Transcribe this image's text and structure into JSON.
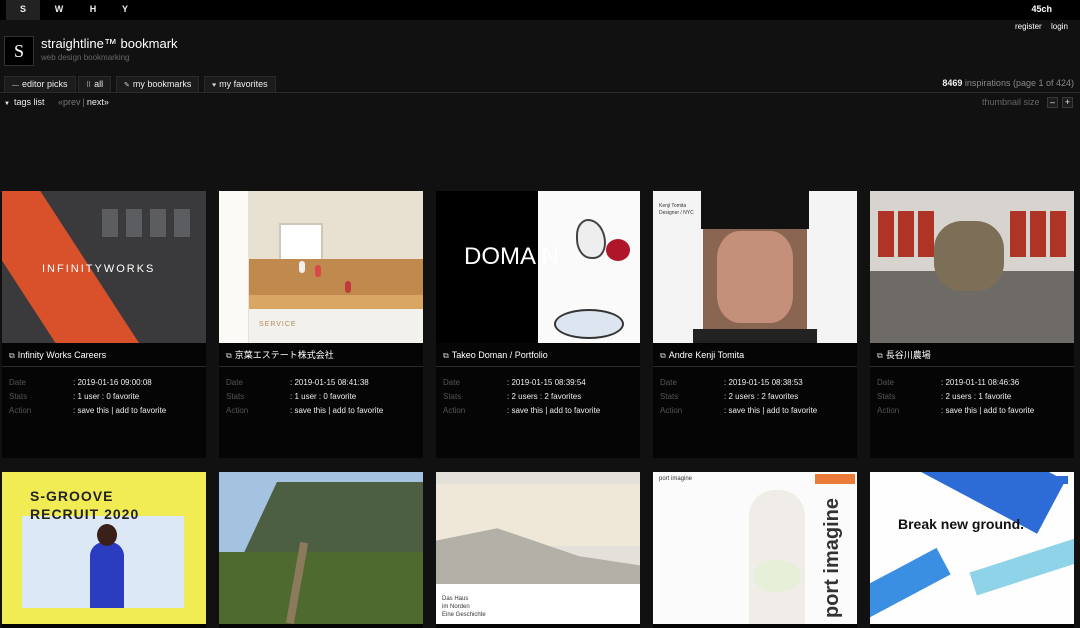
{
  "top_tabs": [
    "S",
    "W",
    "H",
    "Y"
  ],
  "site_code": "45ch",
  "account": {
    "register": "register",
    "login": "login"
  },
  "header": {
    "logo_letter": "S",
    "title": "straightline™ bookmark",
    "subtitle": "web design bookmarking"
  },
  "nav": [
    {
      "icon": "list-icon",
      "glyph": "—",
      "label": "editor picks"
    },
    {
      "icon": "grid-icon",
      "glyph": "⠿",
      "label": "all"
    },
    {
      "icon": "pencil-icon",
      "glyph": "✎",
      "label": "my bookmarks"
    },
    {
      "icon": "heart-icon",
      "glyph": "♥",
      "label": "my favorites"
    }
  ],
  "inspirations": {
    "count": "8469",
    "text": "inspirations (page 1 of 424)"
  },
  "tags_list": "tags list",
  "pager": {
    "prev": "«prev",
    "sep": "|",
    "next": "next»"
  },
  "thumbnail_size": "thumbnail size",
  "size_buttons": {
    "minus": "–",
    "plus": "+"
  },
  "labels": {
    "date": "Date",
    "stats": "Stats",
    "action": "Action"
  },
  "cards": [
    {
      "title": "Infinity Works Careers",
      "date": ": 2019-01-16 09:00:08",
      "stats": ": 1 user : 0 favorite",
      "action": ": save this | add to favorite"
    },
    {
      "title": "京葉エステート株式会社",
      "date": ": 2019-01-15 08:41:38",
      "stats": ": 1 user : 0 favorite",
      "action": ": save this | add to favorite"
    },
    {
      "title": "Takeo Doman / Portfolio",
      "date": ": 2019-01-15 08:39:54",
      "stats": ": 2 users : 2 favorites",
      "action": ": save this | add to favorite"
    },
    {
      "title": "Andre Kenji Tomita",
      "date": ": 2019-01-15 08:38:53",
      "stats": ": 2 users : 2 favorites",
      "action": ": save this | add to favorite"
    },
    {
      "title": "長谷川農場",
      "date": ": 2019-01-11 08:46:36",
      "stats": ": 2 users : 1 favorite",
      "action": ": save this | add to favorite"
    }
  ],
  "thumb_text": {
    "infinity": "INFINITYWORKS",
    "service": "SERVICE",
    "doman": "DOMA    N",
    "sgroove_1": "S-GROOVE",
    "sgroove_2": "RECRUIT 2020",
    "das_haus": "Das Haus",
    "im_norden": "im Norden",
    "eine": "Eine Geschichte",
    "port_logo": "port imagine",
    "port_vert": "port imagine",
    "break": "Break new ground.",
    "kenji_name": "Kenji Tomita",
    "kenji_role": "Designer / NYC"
  }
}
